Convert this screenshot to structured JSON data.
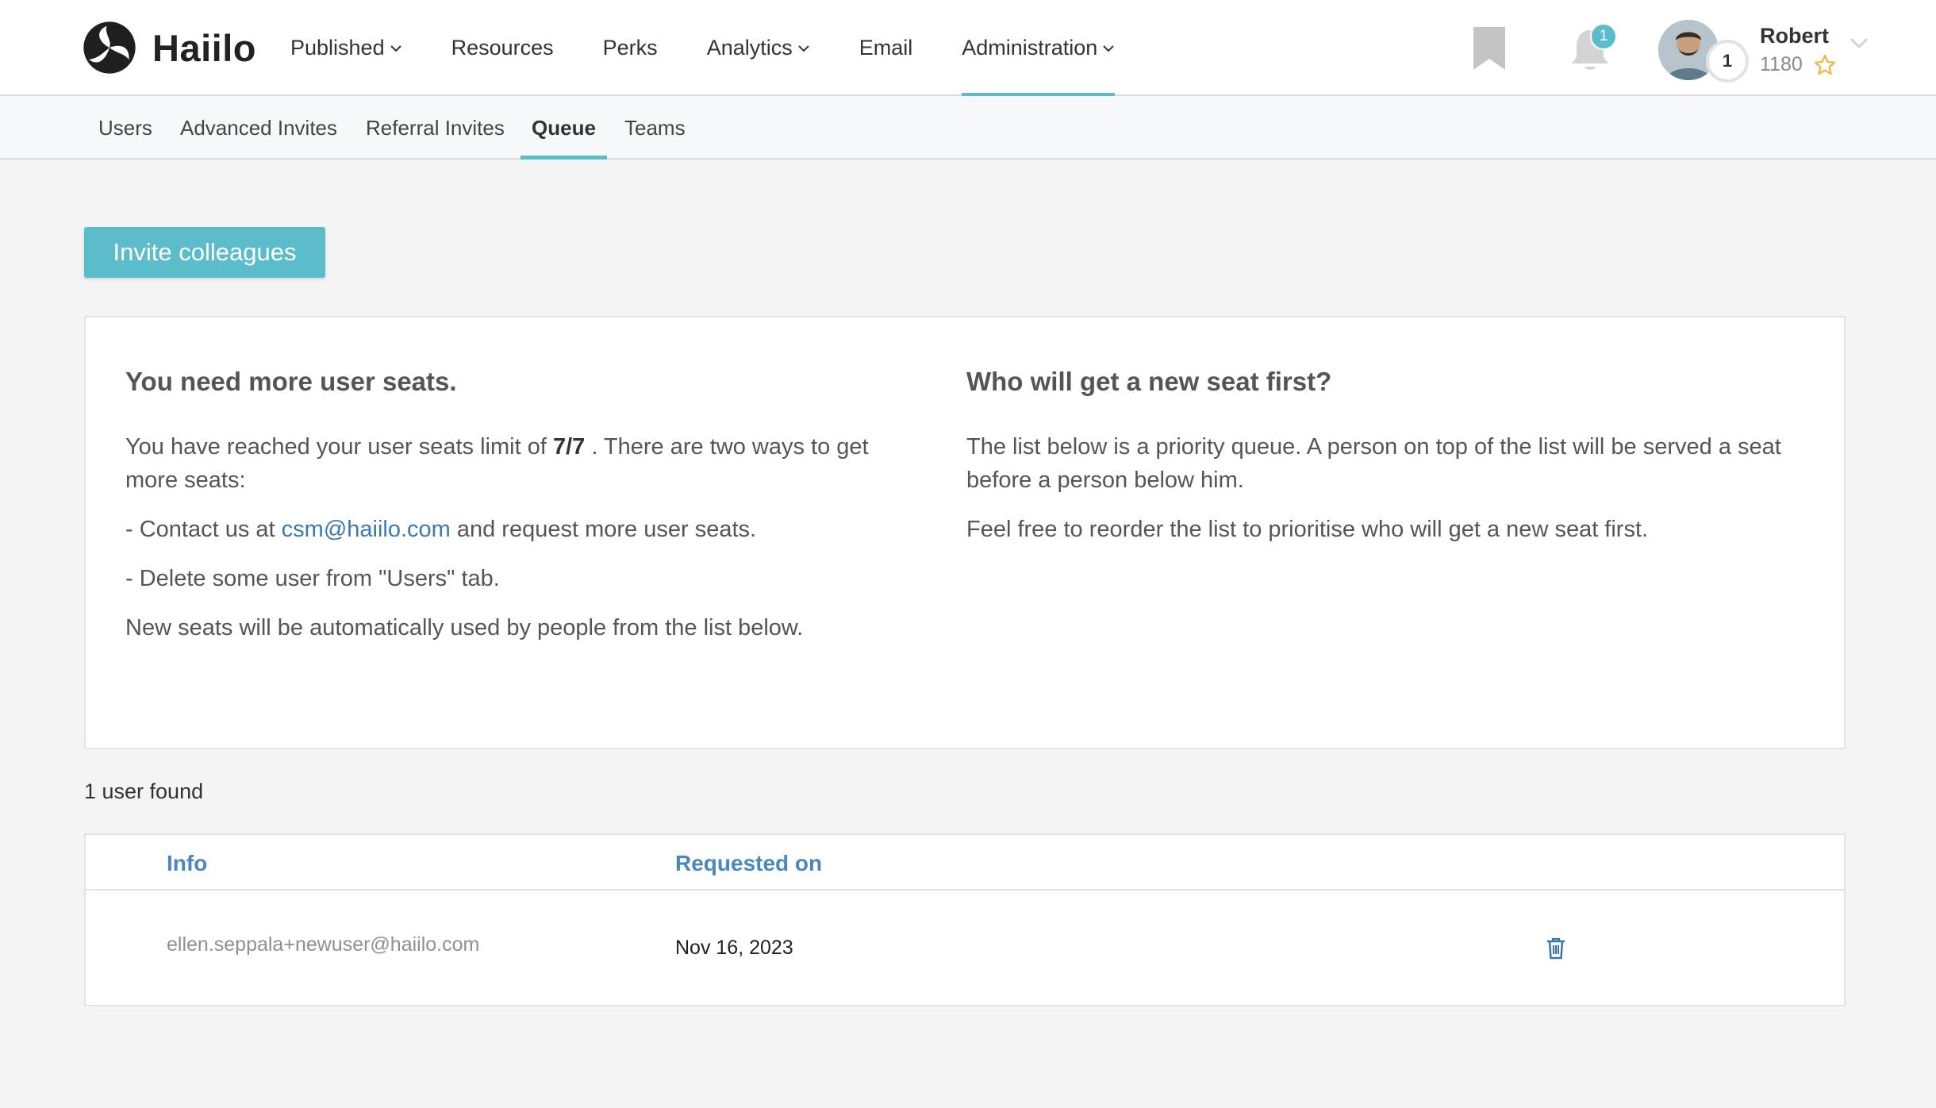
{
  "header": {
    "brand": "Haiilo",
    "nav": [
      {
        "label": "Published",
        "has_dropdown": true,
        "active": false
      },
      {
        "label": "Resources",
        "has_dropdown": false,
        "active": false
      },
      {
        "label": "Perks",
        "has_dropdown": false,
        "active": false
      },
      {
        "label": "Analytics",
        "has_dropdown": true,
        "active": false
      },
      {
        "label": "Email",
        "has_dropdown": false,
        "active": false
      },
      {
        "label": "Administration",
        "has_dropdown": true,
        "active": true
      }
    ],
    "notifications_count": "1",
    "user": {
      "name": "Robert",
      "points": "1180",
      "level": "1"
    }
  },
  "subnav": {
    "items": [
      {
        "label": "Users"
      },
      {
        "label": "Advanced Invites"
      },
      {
        "label": "Referral Invites"
      },
      {
        "label": "Queue"
      },
      {
        "label": "Teams"
      }
    ],
    "active": "Queue"
  },
  "invite_button_label": "Invite colleagues",
  "info": {
    "left": {
      "title": "You need more user seats.",
      "p1_prefix": "You have reached your user seats limit of ",
      "p1_limit": "7/7",
      "p1_suffix": " . There are two ways to get more seats:",
      "p2_prefix": "- Contact us at ",
      "p2_email": "csm@haiilo.com",
      "p2_suffix": " and request more user seats.",
      "p3": "- Delete some user from \"Users\" tab.",
      "p4": "New seats will be automatically used by people from the list below."
    },
    "right": {
      "title": "Who will get a new seat first?",
      "p1": "The list below is a priority queue. A person on top of the list will be served a seat before a person below him.",
      "p2": "Feel free to reorder the list to prioritise who will get a new seat first."
    }
  },
  "results_count_label": "1 user found",
  "table": {
    "columns": {
      "info": "Info",
      "requested_on": "Requested on"
    },
    "rows": [
      {
        "email": "ellen.seppala+newuser@haiilo.com",
        "requested_on": "Nov 16, 2023"
      }
    ]
  },
  "colors": {
    "accent": "#5bbdcb",
    "link": "#3a7ab0",
    "header_link": "#4a87bf"
  },
  "icons": [
    "haiilo-logo-icon",
    "chevron-down-icon",
    "bookmark-icon",
    "bell-icon",
    "star-icon",
    "trash-icon"
  ]
}
